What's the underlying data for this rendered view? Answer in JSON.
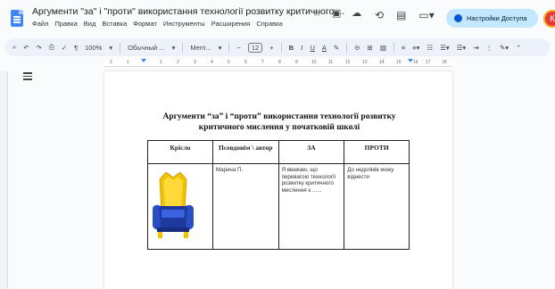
{
  "window": {
    "doc_title": "Аргументи \"за\" і \"проти\" використання технології розвитку критичного ...",
    "share_label": "Настройки Доступа",
    "avatar_letter": "К"
  },
  "menu": [
    "Файл",
    "Правка",
    "Вид",
    "Вставка",
    "Формат",
    "Инструменты",
    "Расширения",
    "Справка"
  ],
  "toolbar": {
    "zoom": "100%",
    "style": "Обычный ...",
    "font": "Merri...",
    "font_size": "12",
    "bold": "B",
    "italic": "I",
    "underline": "U",
    "text_color": "A"
  },
  "ruler": {
    "numbers": [
      "2",
      "1",
      "1",
      "2",
      "3",
      "4",
      "5",
      "6",
      "7",
      "8",
      "9",
      "10",
      "11",
      "12",
      "13",
      "14",
      "15",
      "16",
      "17",
      "18"
    ]
  },
  "document": {
    "heading_line1": "Аргументи “за” і “проти” використання технології розвитку",
    "heading_line2": "критичного мислення у початковій школі",
    "table": {
      "headers": [
        "Крісло",
        "Псевдонім \\ автор",
        "ЗА",
        "ПРОТИ"
      ],
      "row": {
        "author": "Марина П.",
        "pro": "Я вважаю, що перевагою технології розвитку критичного мислення є ......",
        "con": "До недоліків можу віднести"
      }
    }
  },
  "colors": {
    "accent": "#4285f4",
    "share_bg": "#c2e7ff",
    "chair_gold": "#f2c200",
    "chair_blue": "#1f3a9e"
  }
}
